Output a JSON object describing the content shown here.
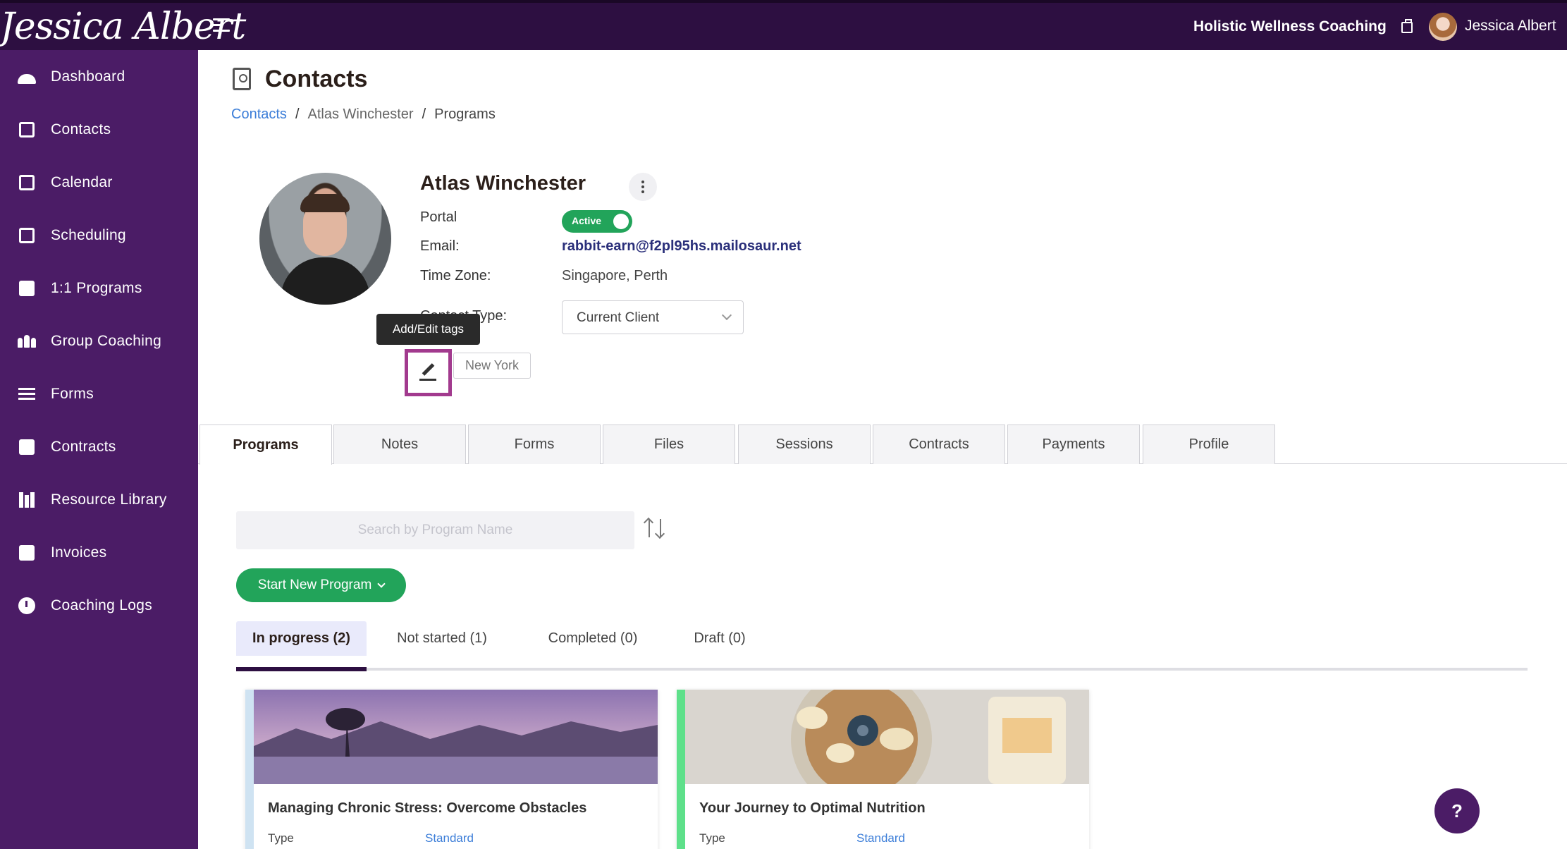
{
  "app": {
    "logo_text": "Jessica Albert",
    "business_name": "Holistic Wellness Coaching",
    "user_name": "Jessica Albert"
  },
  "sidebar": {
    "items": [
      {
        "label": "Dashboard",
        "icon": "gauge-icon"
      },
      {
        "label": "Contacts",
        "icon": "contacts-icon"
      },
      {
        "label": "Calendar",
        "icon": "calendar-icon"
      },
      {
        "label": "Scheduling",
        "icon": "scheduling-icon"
      },
      {
        "label": "1:1 Programs",
        "icon": "book-icon"
      },
      {
        "label": "Group Coaching",
        "icon": "group-icon"
      },
      {
        "label": "Forms",
        "icon": "list-icon"
      },
      {
        "label": "Contracts",
        "icon": "contract-icon"
      },
      {
        "label": "Resource Library",
        "icon": "library-icon"
      },
      {
        "label": "Invoices",
        "icon": "invoice-icon"
      },
      {
        "label": "Coaching Logs",
        "icon": "clock-icon"
      }
    ]
  },
  "page": {
    "title": "Contacts",
    "breadcrumb": {
      "root": "Contacts",
      "contact": "Atlas Winchester",
      "current": "Programs",
      "separator": "/"
    }
  },
  "contact": {
    "name": "Atlas Winchester",
    "portal_label": "Portal",
    "portal_status": "Active",
    "email_label": "Email:",
    "email": "rabbit-earn@f2pl95hs.mailosaur.net",
    "timezone_label": "Time Zone:",
    "timezone": "Singapore, Perth",
    "contact_type_label": "Contact Type:",
    "contact_type": "Current Client",
    "tags": [
      "New York"
    ],
    "tooltip": "Add/Edit tags"
  },
  "tabs": [
    {
      "label": "Programs",
      "active": true
    },
    {
      "label": "Notes"
    },
    {
      "label": "Forms"
    },
    {
      "label": "Files"
    },
    {
      "label": "Sessions"
    },
    {
      "label": "Contracts"
    },
    {
      "label": "Payments"
    },
    {
      "label": "Profile"
    }
  ],
  "programs": {
    "search_placeholder": "Search by Program Name",
    "start_button": "Start New Program",
    "status_tabs": [
      {
        "label": "In progress (2)",
        "active": true
      },
      {
        "label": "Not started (1)"
      },
      {
        "label": "Completed (0)"
      },
      {
        "label": "Draft (0)"
      }
    ],
    "cards": [
      {
        "title": "Managing Chronic Stress: Overcome Obstacles",
        "type_label": "Type",
        "type": "Standard",
        "accent": "#cfe3f2"
      },
      {
        "title": "Your Journey to Optimal Nutrition",
        "type_label": "Type",
        "type": "Standard",
        "accent": "#5ee08a"
      }
    ]
  },
  "help": {
    "label": "?"
  },
  "colors": {
    "topbar": "#2d0f41",
    "sidebar": "#4b1c66",
    "primary_green": "#22a45a",
    "link_blue": "#3b7dd8",
    "highlight": "#a23a8e"
  }
}
